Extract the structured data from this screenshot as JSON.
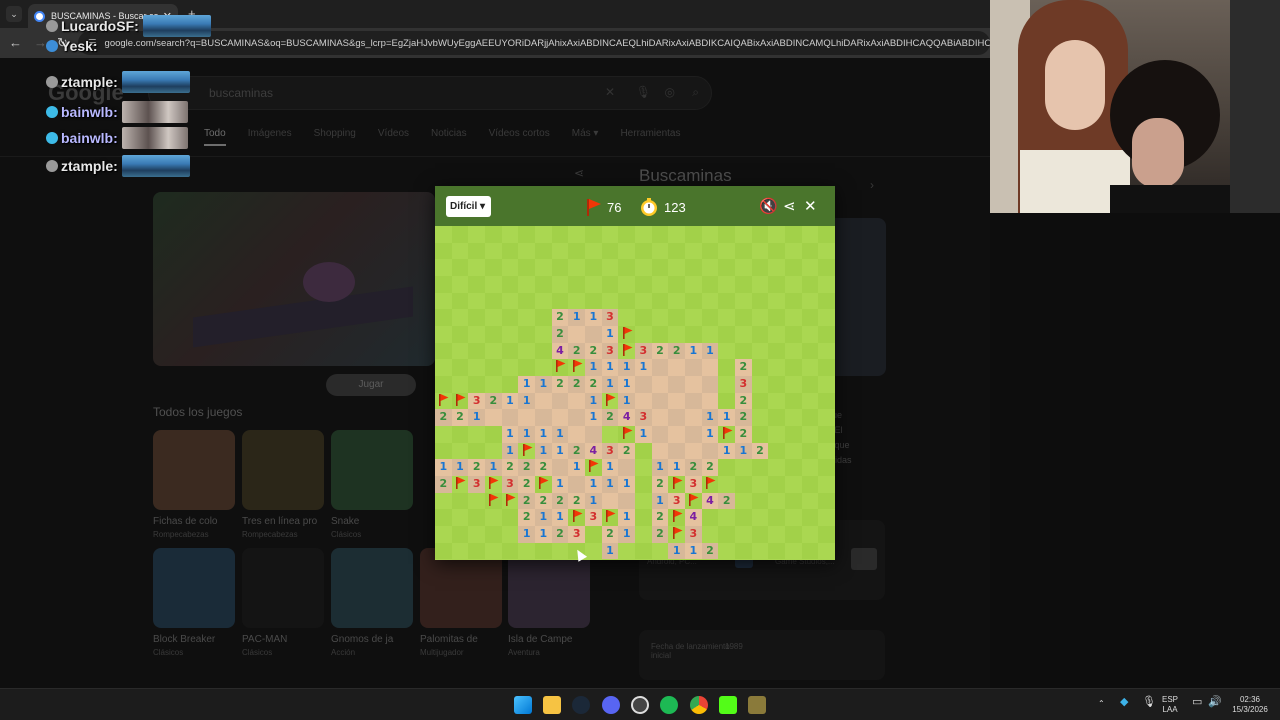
{
  "browser": {
    "tab_title": "BUSCAMINAS - Buscar con Go",
    "url": "google.com/search?q=BUSCAMINAS&oq=BUSCAMINAS&gs_lcrp=EgZjaHJvbWUyEggAEEUYORiDARjjAhixAxiABDINCAEQLhiDARixAxiABDIKCAIQABixAxiABDINCAMQLhiDARixAxiABDIHCAQQABiABDIHCAUQABiABDIH"
  },
  "google": {
    "logo": "Google",
    "query": "buscaminas",
    "tabs": [
      "Todo",
      "Imágenes",
      "Shopping",
      "Vídeos",
      "Noticias",
      "Vídeos cortos",
      "Más ▾",
      "Herramientas"
    ],
    "play_button": "Jugar",
    "games_heading": "Todos los juegos",
    "games": [
      {
        "name": "Fichas de colo",
        "category": "Rompecabezas",
        "color": "#3b2a20"
      },
      {
        "name": "Tres en línea pro",
        "category": "Rompecabezas",
        "color": "#2b2618"
      },
      {
        "name": "Snake",
        "category": "Clásicos",
        "color": "#1e3322"
      },
      {
        "name": "Block Breaker",
        "category": "Clásicos",
        "color": "#1a2b38"
      },
      {
        "name": "PAC-MAN",
        "category": "Clásicos",
        "color": "#141414"
      },
      {
        "name": "Gnomos de ja",
        "category": "Acción",
        "color": "#1c2d33"
      },
      {
        "name": "Palomitas de",
        "category": "Multijugador",
        "color": "#33201c"
      },
      {
        "name": "Isla de Campe",
        "category": "Aventura",
        "color": "#2c2430"
      }
    ],
    "knowledge_title": "Buscaminas",
    "knowledge_text": [
      "gica que",
      "nales. El",
      "en las que",
      "esparcidas"
    ],
    "knowledge_platforms": "dows, Game Boy, Android, PC...",
    "knowledge_dev": "crosoft, Xbox Game Studios,...",
    "knowledge_date_label": "Fecha de lanzamiento inicial",
    "knowledge_date": "1989"
  },
  "chat": [
    {
      "user": "LucardoSF:",
      "color": "#e8e8e8",
      "badge": "#9a9a9a",
      "emote": "car"
    },
    {
      "user": "Yesk:",
      "color": "#e8e8e8",
      "badge": "#3d8ed8",
      "emote": ""
    },
    {
      "user": "ztample:",
      "color": "#e8e8e8",
      "badge": "#9a9a9a",
      "emote": "car"
    },
    {
      "user": "bainwlb:",
      "color": "#b8b8ff",
      "badge": "#3dbbe8",
      "emote": "face"
    },
    {
      "user": "bainwlb:",
      "color": "#b8b8ff",
      "badge": "#3dbbe8",
      "emote": "face"
    },
    {
      "user": "ztample:",
      "color": "#e8e8e8",
      "badge": "#9a9a9a",
      "emote": "car"
    }
  ],
  "minesweeper": {
    "difficulty": "Difícil",
    "flags_left": "76",
    "timer": "123",
    "colors": {
      "header": "#4a752c",
      "grass_light": "#aad751",
      "grass_dark": "#a2d149",
      "dirt_light": "#e5c29f",
      "dirt_dark": "#d7b899",
      "flag": "#f23607"
    },
    "number_colors": {
      "1": "#1976d2",
      "2": "#388e3c",
      "3": "#d32f2f",
      "4": "#7b1fa2"
    },
    "rows": [
      "........................",
      "........................",
      "........................",
      "........................",
      "........................",
      ".......2113.............",
      ".......2..1F............",
      ".......4223F32211.......",
      ".......FF1111.....2.....",
      ".....1122211......3.....",
      "FF3211...1F1......2.....",
      "221......1243...112.....",
      "....1111..#F1...1F2.....",
      "....1F112432.....112....",
      "1121222.1F1..1122.......",
      "2F3F32F1.111.2F3F.......",
      "...FF22221...13F42......",
      ".....211F3F1.2F4........",
      ".....1123.21.2F3........",
      "..........1...112......."
    ]
  },
  "taskbar": {
    "lang1": "ESP",
    "lang2": "LAA",
    "time": "02:36",
    "date": "15/3/2026"
  }
}
